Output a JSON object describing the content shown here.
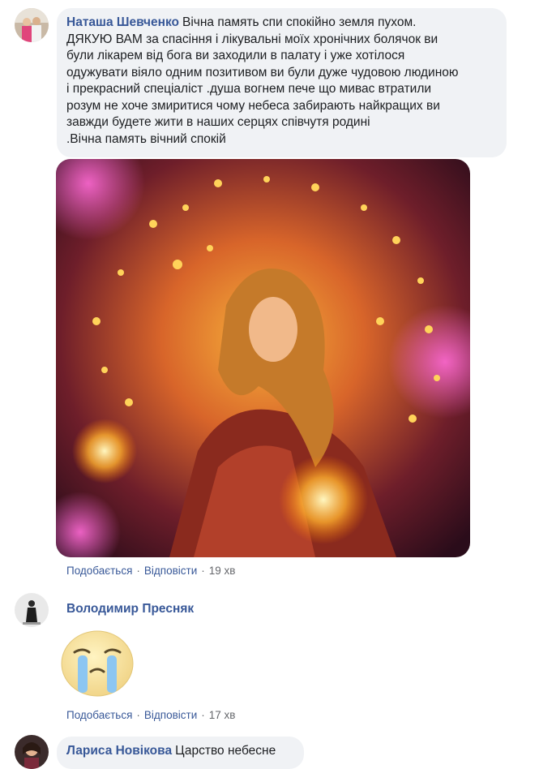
{
  "comments": [
    {
      "author": "Наташа Шевченко",
      "lines": [
        "Вічна память спи спокійно земля пухом.",
        "ДЯКУЮ ВАМ за спасіння і лікувальні моїх хронічних болячок ви",
        "були лікарем від бога ви заходили в палату і уже хотілося",
        "одужувати віяло одним позитивом ви були дуже чудовою людиною",
        "і прекрасний спеціаліст .душа вогнем пече що мивас втратили",
        "розум не хоче змиритися чому небеса забирають найкращих ви",
        "завжди будете жити в наших серцях співчутя родині",
        ".Вічна память вічний спокій"
      ],
      "like": "Подобається",
      "reply": "Відповісти",
      "time": "19 хв"
    },
    {
      "author": "Володимир Пресняк",
      "like": "Подобається",
      "reply": "Відповісти",
      "time": "17 хв"
    },
    {
      "author": "Лариса Новікова",
      "text": "Царство небесне"
    }
  ],
  "separator": "·",
  "colors": {
    "author": "#385898",
    "bubble": "#f0f2f5",
    "meta": "#65676b"
  },
  "icons": {
    "sticker": "crying-face-sticker",
    "image": "fire-spirit-girl-image"
  }
}
